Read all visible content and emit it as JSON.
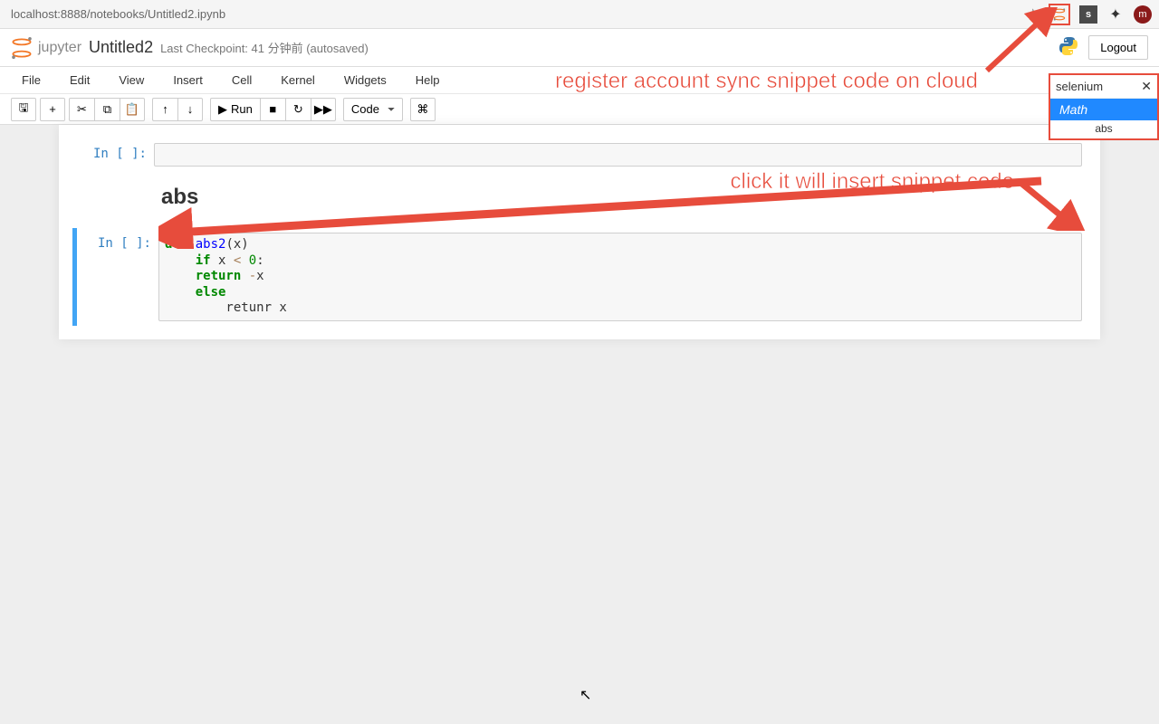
{
  "browser": {
    "url": "localhost:8888/notebooks/Untitled2.ipynb"
  },
  "header": {
    "logo_text": "jupyter",
    "notebook_name": "Untitled2",
    "checkpoint": "Last Checkpoint: 41 分钟前  (autosaved)",
    "logout": "Logout"
  },
  "menus": {
    "file": "File",
    "edit": "Edit",
    "view": "View",
    "insert": "Insert",
    "cell": "Cell",
    "kernel": "Kernel",
    "widgets": "Widgets",
    "help": "Help"
  },
  "kernel": {
    "name": "Python 3"
  },
  "toolbar": {
    "run": "Run",
    "cell_type": "Code"
  },
  "cells": {
    "prompt_empty": "In [ ]:",
    "md_heading": "abs",
    "code_lines": [
      {
        "pre": "",
        "kw": "def ",
        "fn": "abs2",
        "rest": "(x)"
      },
      {
        "pre": "    ",
        "kw": "if",
        "rest": " x "
      },
      {
        "pre": "    ",
        "kw": "return",
        "rest": " ",
        "op": "-",
        "rest2": "x"
      },
      {
        "pre": "    ",
        "kw": "else",
        "rest": ""
      },
      {
        "pre": "        ",
        "plain": "retunr x"
      }
    ]
  },
  "snippet": {
    "title": "selenium",
    "category": "Math",
    "item": "abs"
  },
  "annotations": {
    "a1": "register account sync snippet code on cloud",
    "a2": "click it will insert snippet code"
  }
}
